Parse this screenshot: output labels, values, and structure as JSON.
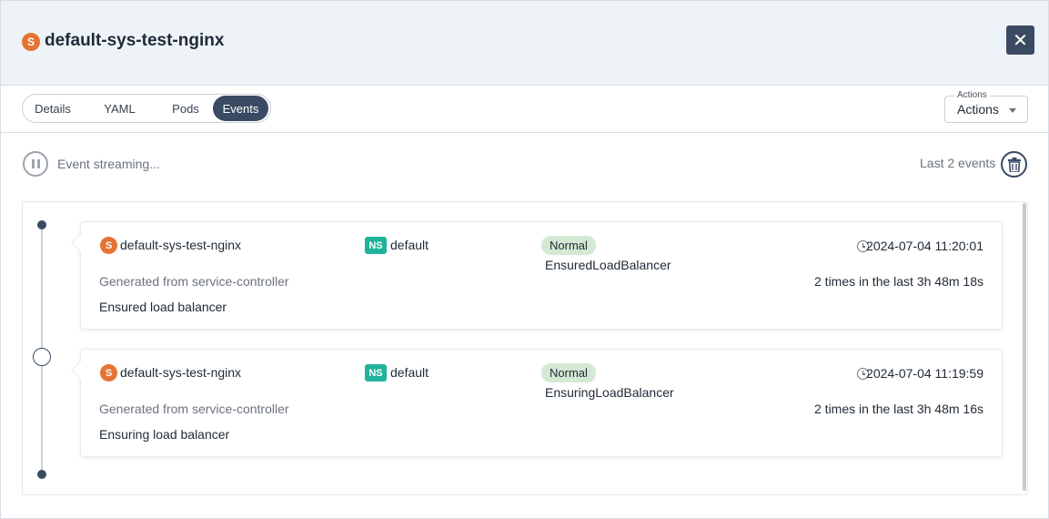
{
  "header": {
    "kind_letter": "S",
    "title": "default-sys-test-nginx",
    "close_glyph": "✕"
  },
  "tabs": [
    {
      "label": "Details",
      "active": false
    },
    {
      "label": "YAML",
      "active": false
    },
    {
      "label": "Pods",
      "active": false
    },
    {
      "label": "Events",
      "active": true
    }
  ],
  "actions": {
    "legend": "Actions",
    "value": "Actions"
  },
  "stream": {
    "status": "Event streaming...",
    "count_label": "Last 2 events"
  },
  "events": [
    {
      "kind_letter": "S",
      "name": "default-sys-test-nginx",
      "ns_badge": "NS",
      "namespace": "default",
      "type": "Normal",
      "reason": "EnsuredLoadBalancer",
      "timestamp": "2024-07-04 11:20:01",
      "source": "Generated from service-controller",
      "count_text": "2 times in the last 3h 48m 18s",
      "message": "Ensured load balancer"
    },
    {
      "kind_letter": "S",
      "name": "default-sys-test-nginx",
      "ns_badge": "NS",
      "namespace": "default",
      "type": "Normal",
      "reason": "EnsuringLoadBalancer",
      "timestamp": "2024-07-04 11:19:59",
      "source": "Generated from service-controller",
      "count_text": "2 times in the last 3h 48m 16s",
      "message": "Ensuring load balancer"
    }
  ],
  "colors": {
    "primary": "#3a4a63",
    "kind_badge": "#e57334",
    "ns_badge": "#20b39b",
    "normal_chip": "#d3e9d3",
    "header_bg": "#eef3f8"
  },
  "icons": {
    "close": "close-icon",
    "pause": "pause-icon",
    "trash": "trash-icon",
    "clock": "clock-icon",
    "caret": "caret-down-icon"
  }
}
